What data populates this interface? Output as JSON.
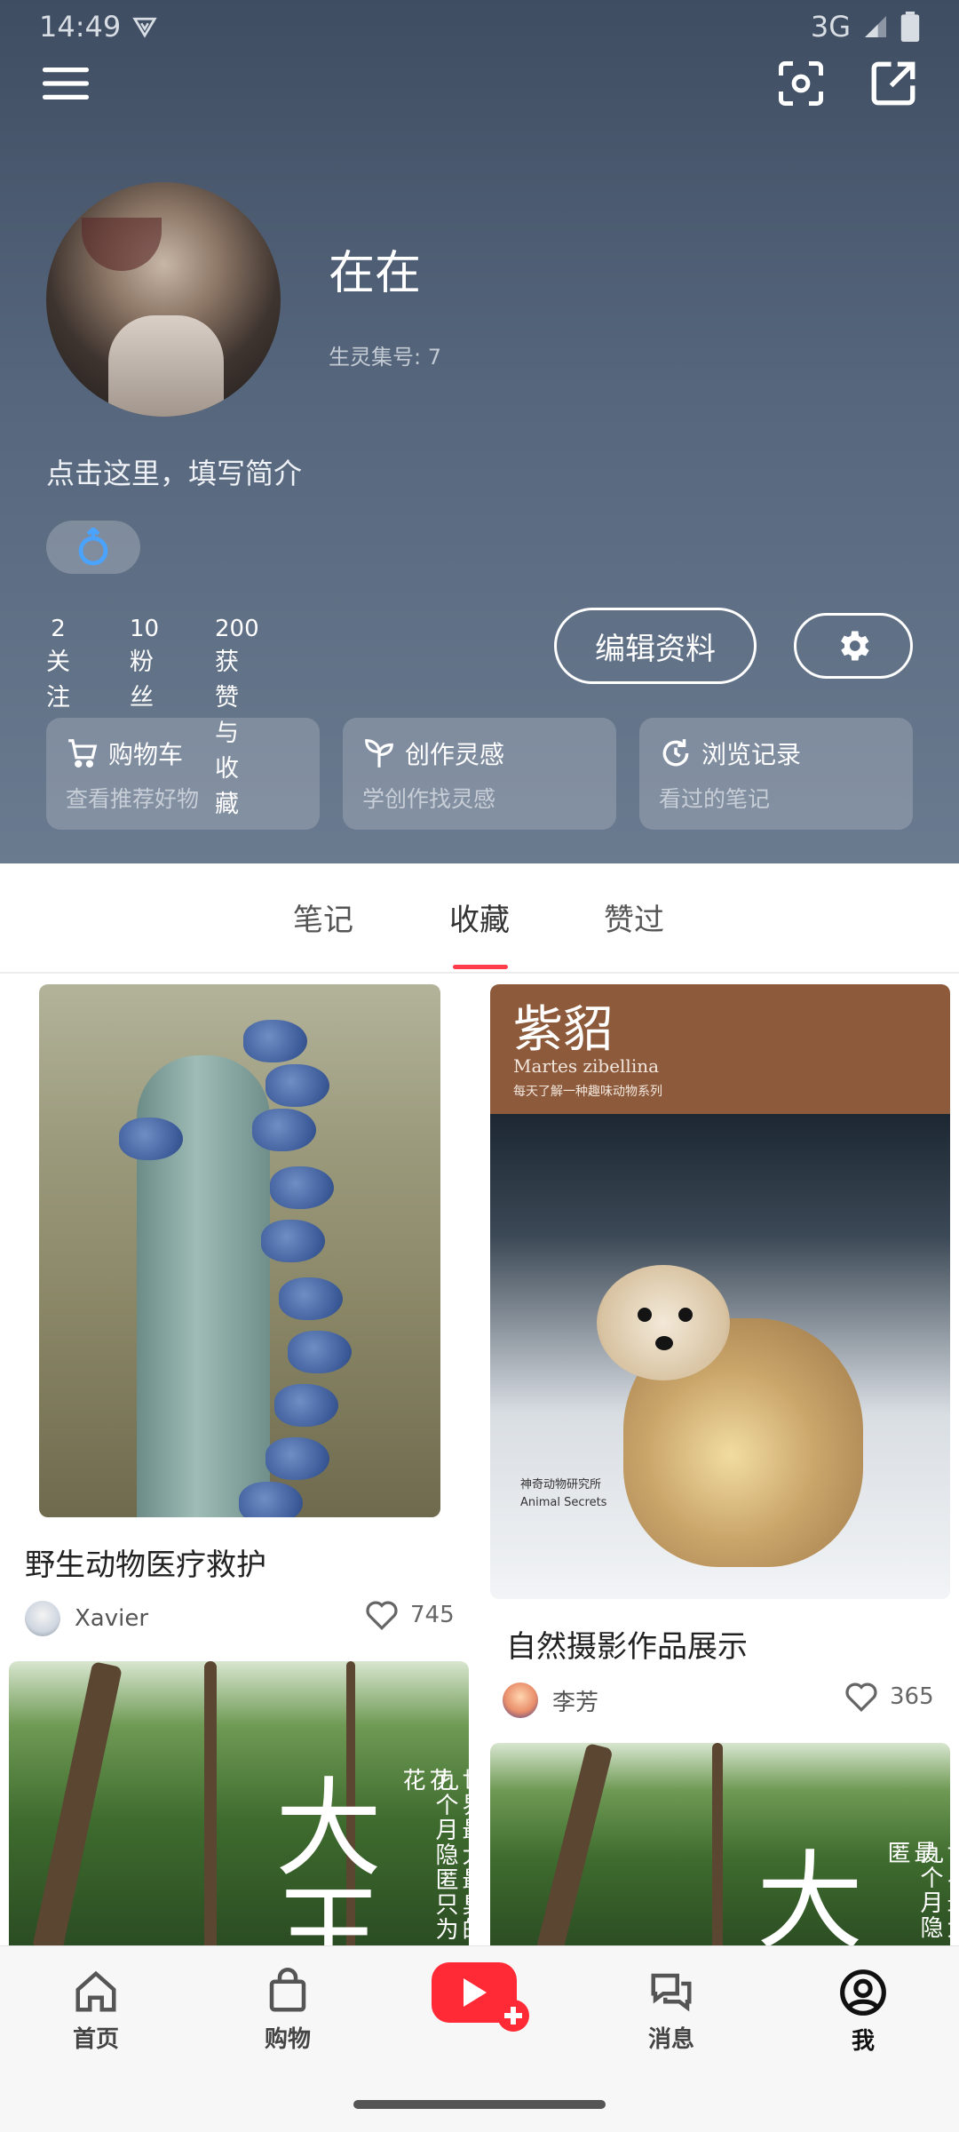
{
  "status_bar": {
    "time": "14:49",
    "network": "3G"
  },
  "profile": {
    "nickname": "在在",
    "user_id": "生灵集号: 7",
    "bio": "点击这里，填写简介"
  },
  "stats": [
    {
      "value": "2",
      "label": "关注"
    },
    {
      "value": "10",
      "label": "粉丝"
    },
    {
      "value": "200",
      "label": "获赞与收藏"
    }
  ],
  "edit_button": "编辑资料",
  "shortcuts": [
    {
      "title": "购物车",
      "subtitle": "查看推荐好物",
      "icon": "cart-icon"
    },
    {
      "title": "创作灵感",
      "subtitle": "学创作找灵感",
      "icon": "sprout-icon"
    },
    {
      "title": "浏览记录",
      "subtitle": "看过的笔记",
      "icon": "history-icon"
    }
  ],
  "tabs": [
    {
      "label": "笔记"
    },
    {
      "label": "收藏"
    },
    {
      "label": "赞过"
    }
  ],
  "active_tab": "收藏",
  "feed": {
    "left": [
      {
        "title": "野生动物医疗救护",
        "author": "Xavier",
        "likes": "745"
      },
      {
        "cover_big_char": "大王",
        "cover_vertical": [
          "世界最大最臭的花",
          "九个月隐匿只为花"
        ]
      }
    ],
    "right": [
      {
        "cover_title": "紫貂",
        "cover_latin": "Martes zibellina",
        "cover_subtitle": "每天了解一种趣味动物系列",
        "cover_footer": [
          "神奇动物研究所",
          "Animal Secrets"
        ],
        "title": "自然摄影作品展示",
        "author": "李芳",
        "likes": "365"
      },
      {
        "cover_big_char": "大",
        "cover_vertical": [
          "世界最大最",
          "九个月隐匿"
        ]
      }
    ]
  },
  "bottom_nav": [
    {
      "label": "首页",
      "icon": "home-icon"
    },
    {
      "label": "购物",
      "icon": "shopping-bag-icon"
    },
    {
      "label": "消息",
      "icon": "chat-icon"
    },
    {
      "label": "我",
      "icon": "profile-icon"
    }
  ],
  "colors": {
    "accent": "#ff3d4a",
    "header": "#56667c",
    "publish": "#ff2a35"
  }
}
